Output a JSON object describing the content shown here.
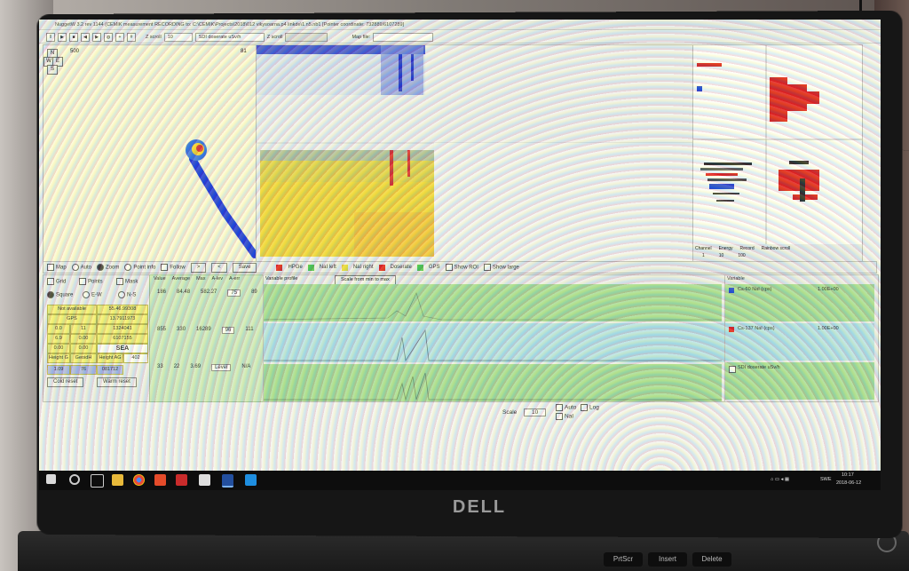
{
  "app": {
    "title": "NuggetW 3.2 rev 1144 (CEMIK measurement RECORDING to: C:\\CEMIK\\Projects\\2018\\012 vikysoarna.p4 linkde\\1.n5.nb1  [Pointer coordinate: 732889/6107289]",
    "zscroll_label": "Z scroll",
    "zscroll_value": "10",
    "dose_select": "SDI doserate uSv/h",
    "zscroll2_label": "Z scroll",
    "map_file_label": "Map file:"
  },
  "map": {
    "nav": [
      "N",
      "W",
      "E",
      "S"
    ],
    "scale_left": "500",
    "scale_right": "81"
  },
  "controls": {
    "map": "Map",
    "auto": "Auto",
    "zoom": "Zoom",
    "point_info": "Point info",
    "follow": "Follow",
    "next": ">",
    "prev": "<",
    "save": "Save",
    "legend": [
      "HPGe",
      "NaI left",
      "NaI right",
      "Doserate",
      "GPS"
    ],
    "show_roi": "Show ROI",
    "show_large": "Show large",
    "spect_rr": "spectr rr"
  },
  "left": {
    "grid": "Grid",
    "points": "Points",
    "mask": "Mask",
    "square": "Square",
    "ew": "E-W",
    "ns": "N-S",
    "cells": [
      [
        "Not available",
        "55.46.99308"
      ],
      [
        "GPS",
        "13.7911973"
      ],
      [
        "0.0",
        "11",
        "1324041"
      ],
      [
        "6.9",
        "0.00",
        "6107155"
      ],
      [
        "0.00",
        "0.00",
        "SEA"
      ],
      [
        "Height G",
        "GeoidH",
        "Height AG",
        "402"
      ],
      [
        "1.09",
        "76",
        "081712"
      ]
    ],
    "cold_reset": "Cold reset",
    "warm_reset": "Warm reset"
  },
  "stats": {
    "headers": [
      "Value",
      "Average",
      "Max",
      "A-lev",
      "A-err"
    ],
    "rows": [
      [
        "186",
        "84.48",
        "582.27",
        "75",
        "89"
      ],
      [
        "855",
        "330",
        "16289",
        "96",
        "111"
      ],
      [
        "33",
        "22",
        "3.69",
        "Level",
        "N/A"
      ]
    ]
  },
  "profiles": {
    "header": "Variable profile",
    "scale_btn": "Scale from min to max"
  },
  "variables": {
    "header": "Variable",
    "items": [
      {
        "name": "Cs-60 NaI (cps)",
        "value": "1.00E+00"
      },
      {
        "name": "Cs-137 NaI (cps)",
        "value": "1.00E+00"
      },
      {
        "name": "SDI doserate uSv/h",
        "value": ""
      }
    ],
    "meta": [
      "Channel",
      "Energy",
      "Record",
      "Rainbow scroll"
    ],
    "meta_vals": [
      "1",
      "10",
      "100"
    ]
  },
  "scale": {
    "label": "Scale",
    "value": "10",
    "auto": "Auto",
    "log": "Log",
    "nai": "NaI"
  },
  "taskbar": {
    "time": "10:17",
    "date": "2018-06-12",
    "lang": "SWE"
  },
  "brand": "DELL",
  "keys": [
    "PrtScr",
    "Insert",
    "Delete"
  ],
  "colors": {
    "panel_green": "#a6dd9a",
    "panel_blue": "#b6e3ec",
    "spectrum_yellow": "#f0e04a",
    "red_bar": "#e01818",
    "blue_bar": "#1a3fd8"
  }
}
